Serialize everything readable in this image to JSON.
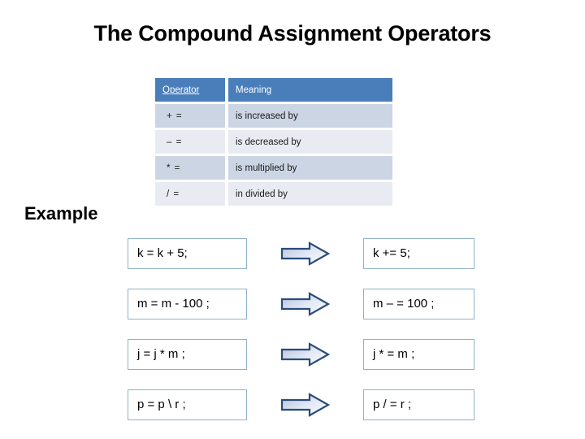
{
  "slide": {
    "title": "The Compound Assignment Operators",
    "example_heading": "Example"
  },
  "colors": {
    "header_blue": "#4a7ebb",
    "row_dark": "#ccd5e4",
    "row_light": "#e8ebf2",
    "box_border": "#8fb2c9",
    "arrow_border": "#2a4d7a",
    "arrow_fill_start": "#b8c4dd",
    "arrow_fill_end": "#f6f8fd",
    "text": "#000000"
  },
  "table": {
    "headers": [
      "Operator",
      "Meaning"
    ],
    "rows": [
      {
        "operator": "+ =",
        "meaning": "is increased by"
      },
      {
        "operator": "– =",
        "meaning": "is decreased by"
      },
      {
        "operator": "* =",
        "meaning": "is multiplied by"
      },
      {
        "operator": "/  =",
        "meaning": "in divided by"
      }
    ]
  },
  "examples": [
    {
      "before": "k = k + 5;",
      "after": "k += 5;",
      "arrow": "right-arrow-icon"
    },
    {
      "before": "m = m - 100 ;",
      "after": "m – = 100 ;",
      "arrow": "right-arrow-icon"
    },
    {
      "before": "j = j * m ;",
      "after": "j * = m ;",
      "arrow": "right-arrow-icon"
    },
    {
      "before": "p = p \\ r ;",
      "after": "p / = r ;",
      "arrow": "right-arrow-icon"
    }
  ]
}
